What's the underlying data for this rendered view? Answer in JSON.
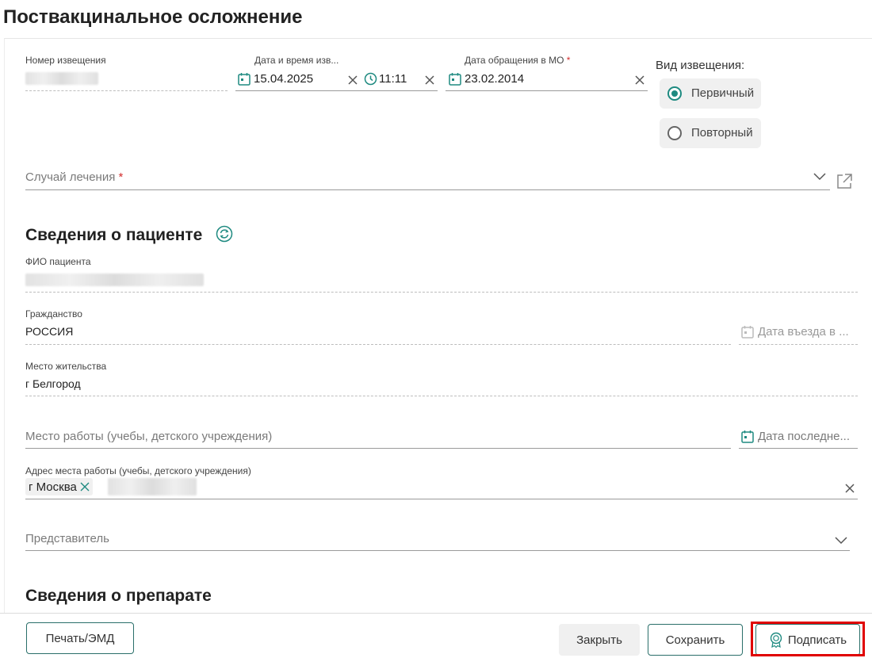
{
  "page": {
    "title": "Поствакцинальное осложнение"
  },
  "notice": {
    "number_label": "Номер извещения",
    "datetime_label": "Дата и время изв...",
    "date_value": "15.04.2025",
    "time_value": "11:11",
    "appeal_date_label": "Дата обращения в МО",
    "appeal_date_value": "23.02.2014",
    "required_mark": "*",
    "type_label": "Вид извещения:",
    "type_options": [
      "Первичный",
      "Повторный"
    ],
    "type_selected": "Первичный"
  },
  "treatment_case": {
    "placeholder": "Случай лечения",
    "required_mark": "*"
  },
  "patient": {
    "section_title": "Сведения о пациенте",
    "fio_label": "ФИО пациента",
    "citizenship_label": "Гражданство",
    "citizenship_value": "РОССИЯ",
    "entry_date_placeholder": "Дата въезда в ...",
    "residence_label": "Место жительства",
    "residence_value": "г Белгород",
    "workplace_placeholder": "Место работы (учебы, детского учреждения)",
    "last_date_placeholder": "Дата последне...",
    "work_address_label": "Адрес места работы (учебы, детского учреждения)",
    "work_address_chip": "г Москва",
    "representative_placeholder": "Представитель"
  },
  "drug": {
    "section_title": "Сведения о препарате"
  },
  "footer": {
    "print_label": "Печать/ЭМД",
    "close_label": "Закрыть",
    "save_label": "Сохранить",
    "sign_label": "Подписать"
  },
  "colors": {
    "accent": "#1e8a80",
    "required": "#d32f2f",
    "highlight": "#e00000"
  }
}
